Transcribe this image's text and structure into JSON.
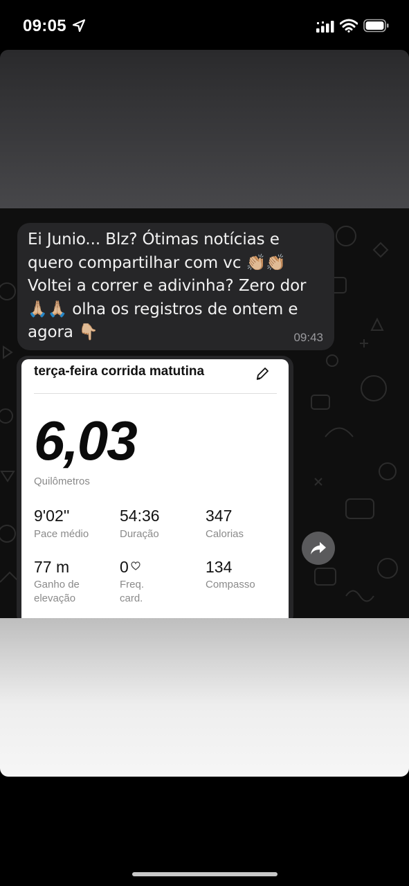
{
  "status_bar": {
    "time": "09:05"
  },
  "message": {
    "text": "Ei Junio... Blz? Ótimas notícias e quero compartilhar com vc 👏🏼👏🏼 Voltei a correr e adivinha? Zero dor 🙏🏼🙏🏼 olha os registros de ontem e agora 👇🏼",
    "time": "09:43"
  },
  "run_card": {
    "title": "terça-feira corrida matutina",
    "distance": "6,03",
    "distance_unit": "Quilômetros",
    "stats": [
      {
        "value": "9'02''",
        "label": "Pace médio"
      },
      {
        "value": "54:36",
        "label": "Duração"
      },
      {
        "value": "347",
        "label": "Calorias"
      },
      {
        "value": "77 m",
        "label": "Ganho de elevação"
      },
      {
        "value": "0",
        "label": "Freq. card."
      },
      {
        "value": "134",
        "label": "Compasso"
      }
    ]
  },
  "icons": {
    "location": "location-arrow-icon",
    "signal": "cellular-signal-icon",
    "wifi": "wifi-icon",
    "battery": "battery-icon",
    "edit": "pencil-icon",
    "heart": "heart-icon",
    "share": "share-icon"
  }
}
